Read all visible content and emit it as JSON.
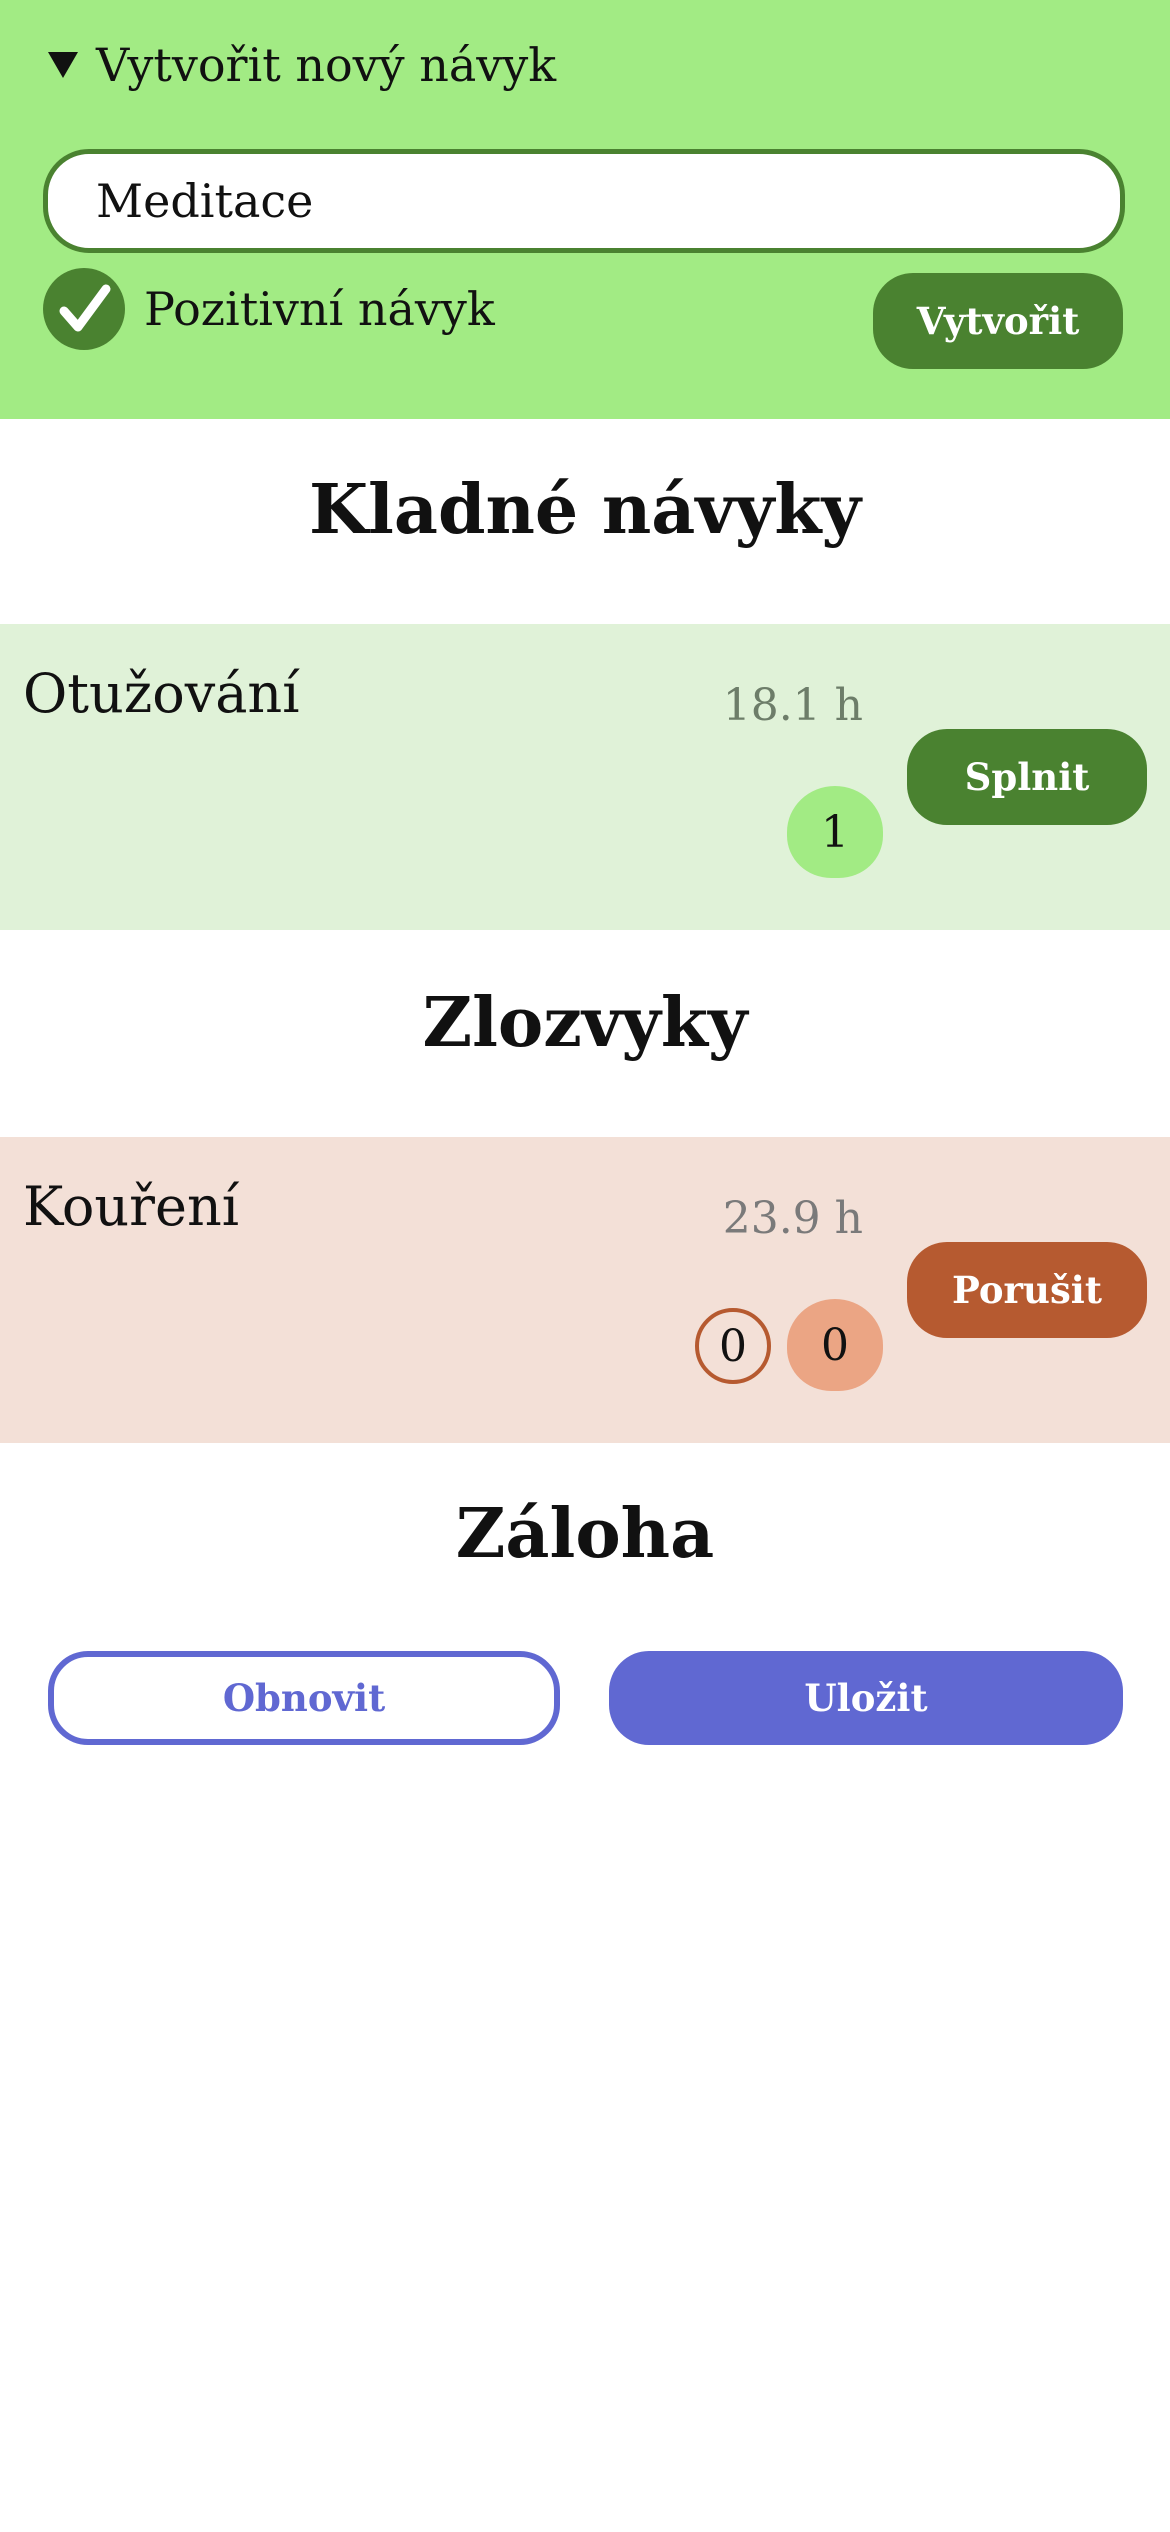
{
  "create": {
    "summary_label": "Vytvořit nový návyk",
    "name_value": "Meditace",
    "positive_label": "Pozitivní návyk",
    "positive_checked": true,
    "create_label": "Vytvořit"
  },
  "sections": {
    "positive_title": "Kladné návyky",
    "negative_title": "Zlozvyky",
    "backup_title": "Záloha"
  },
  "positive_habits": [
    {
      "name": "Otužování",
      "time": "18.1 h",
      "count": "1",
      "action_label": "Splnit"
    }
  ],
  "negative_habits": [
    {
      "name": "Kouření",
      "time": "23.9 h",
      "count_outline": "0",
      "count": "0",
      "action_label": "Porušit"
    }
  ],
  "backup": {
    "restore_label": "Obnovit",
    "save_label": "Uložit"
  },
  "colors": {
    "positive_accent": "#4a8230",
    "positive_light": "#a2eb84",
    "positive_card": "#e0f2d8",
    "negative_accent": "#b65a30",
    "negative_light": "#eba584",
    "negative_card": "#f3e0d7",
    "backup_accent": "#6068d2"
  }
}
